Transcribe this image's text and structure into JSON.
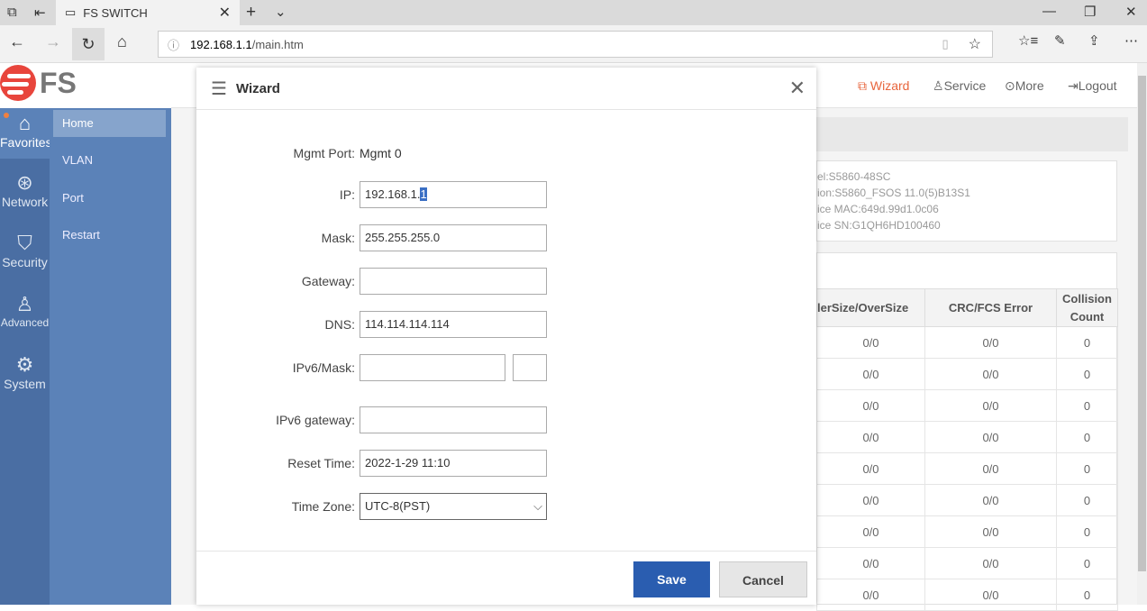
{
  "browser": {
    "tab_title": "FS SWITCH",
    "url_host": "192.168.1.1",
    "url_path": "/main.htm"
  },
  "brand": {
    "logo_text": "FS",
    "accent": "#e8453c"
  },
  "icon_nav": [
    {
      "label": "Favorites",
      "icon": "home-icon"
    },
    {
      "label": "Network",
      "icon": "globe-icon"
    },
    {
      "label": "Security",
      "icon": "shield-icon"
    },
    {
      "label": "Advanced",
      "icon": "user-gear-icon"
    },
    {
      "label": "System",
      "icon": "gear-icon"
    }
  ],
  "sub_nav": [
    "Home",
    "VLAN",
    "Port",
    "Restart"
  ],
  "top_nav": {
    "wizard": "Wizard",
    "service": "Service",
    "more": "More",
    "logout": "Logout"
  },
  "device_info": [
    "el:S5860-48SC",
    "ion:S5860_FSOS 11.0(5)B13S1",
    "ice MAC:649d.99d1.0c06",
    "ice SN:G1QH6HD100460"
  ],
  "table": {
    "headers": [
      "lerSize/OverSize",
      "CRC/FCS Error",
      "Collision Count"
    ],
    "rows": [
      [
        "0/0",
        "0/0",
        "0"
      ],
      [
        "0/0",
        "0/0",
        "0"
      ],
      [
        "0/0",
        "0/0",
        "0"
      ],
      [
        "0/0",
        "0/0",
        "0"
      ],
      [
        "0/0",
        "0/0",
        "0"
      ],
      [
        "0/0",
        "0/0",
        "0"
      ],
      [
        "0/0",
        "0/0",
        "0"
      ],
      [
        "0/0",
        "0/0",
        "0"
      ],
      [
        "0/0",
        "0/0",
        "0"
      ]
    ]
  },
  "wizard": {
    "title": "Wizard",
    "mgmt_label": "Mgmt Port:",
    "mgmt_value": "Mgmt 0",
    "ip_label": "IP:",
    "ip_value_a": "192.168.1.",
    "ip_value_b": "1",
    "mask_label": "Mask:",
    "mask_value": "255.255.255.0",
    "gateway_label": "Gateway:",
    "gateway_value": "",
    "dns_label": "DNS:",
    "dns_value": "114.114.114.114",
    "ipv6_label": "IPv6/Mask:",
    "ipv6_value": "",
    "ipv6_mask": "",
    "ipv6gw_label": "IPv6 gateway:",
    "ipv6gw_value": "",
    "reset_label": "Reset Time:",
    "reset_value": "2022-1-29 11:10",
    "tz_label": "Time Zone:",
    "tz_value": "UTC-8(PST)",
    "save": "Save",
    "cancel": "Cancel",
    "primary_color": "#2a5db0"
  }
}
